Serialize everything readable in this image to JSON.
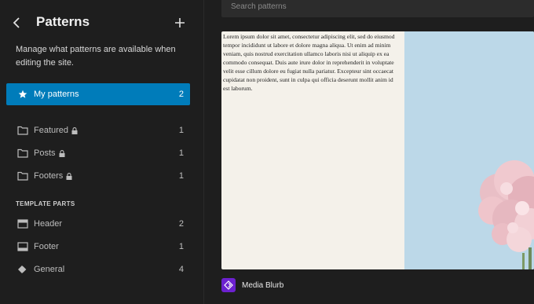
{
  "sidebar": {
    "title": "Patterns",
    "description": "Manage what patterns are available when editing the site.",
    "items": [
      {
        "label": "My patterns",
        "count": "2"
      },
      {
        "label": "Featured",
        "count": "1"
      },
      {
        "label": "Posts",
        "count": "1"
      },
      {
        "label": "Footers",
        "count": "1"
      }
    ],
    "section_heading": "TEMPLATE PARTS",
    "template_parts": [
      {
        "label": "Header",
        "count": "2"
      },
      {
        "label": "Footer",
        "count": "1"
      },
      {
        "label": "General",
        "count": "4"
      }
    ]
  },
  "main": {
    "search_placeholder": "Search patterns",
    "preview_text": "Lorem ipsum dolor sit amet, consectetur adipiscing elit, sed do eiusmod tempor incididunt ut labore et dolore magna aliqua. Ut enim ad minim veniam, quis nostrud exercitation ullamco laboris nisi ut aliquip ex ea commodo consequat. Duis aute irure dolor in reprehenderit in voluptate velit esse cillum dolore eu fugiat nulla pariatur. Excepteur sint occaecat cupidatat non proident, sunt in culpa qui officia deserunt mollit anim id est laborum.",
    "pattern_name": "Media Blurb"
  },
  "colors": {
    "accent": "#007cba",
    "pattern_icon": "#6c21d0"
  },
  "icons": [
    "chevron-left-icon",
    "plus-icon",
    "star-icon",
    "folder-icon",
    "lock-icon",
    "header-icon",
    "footer-icon",
    "diamond-icon",
    "pattern-icon"
  ]
}
